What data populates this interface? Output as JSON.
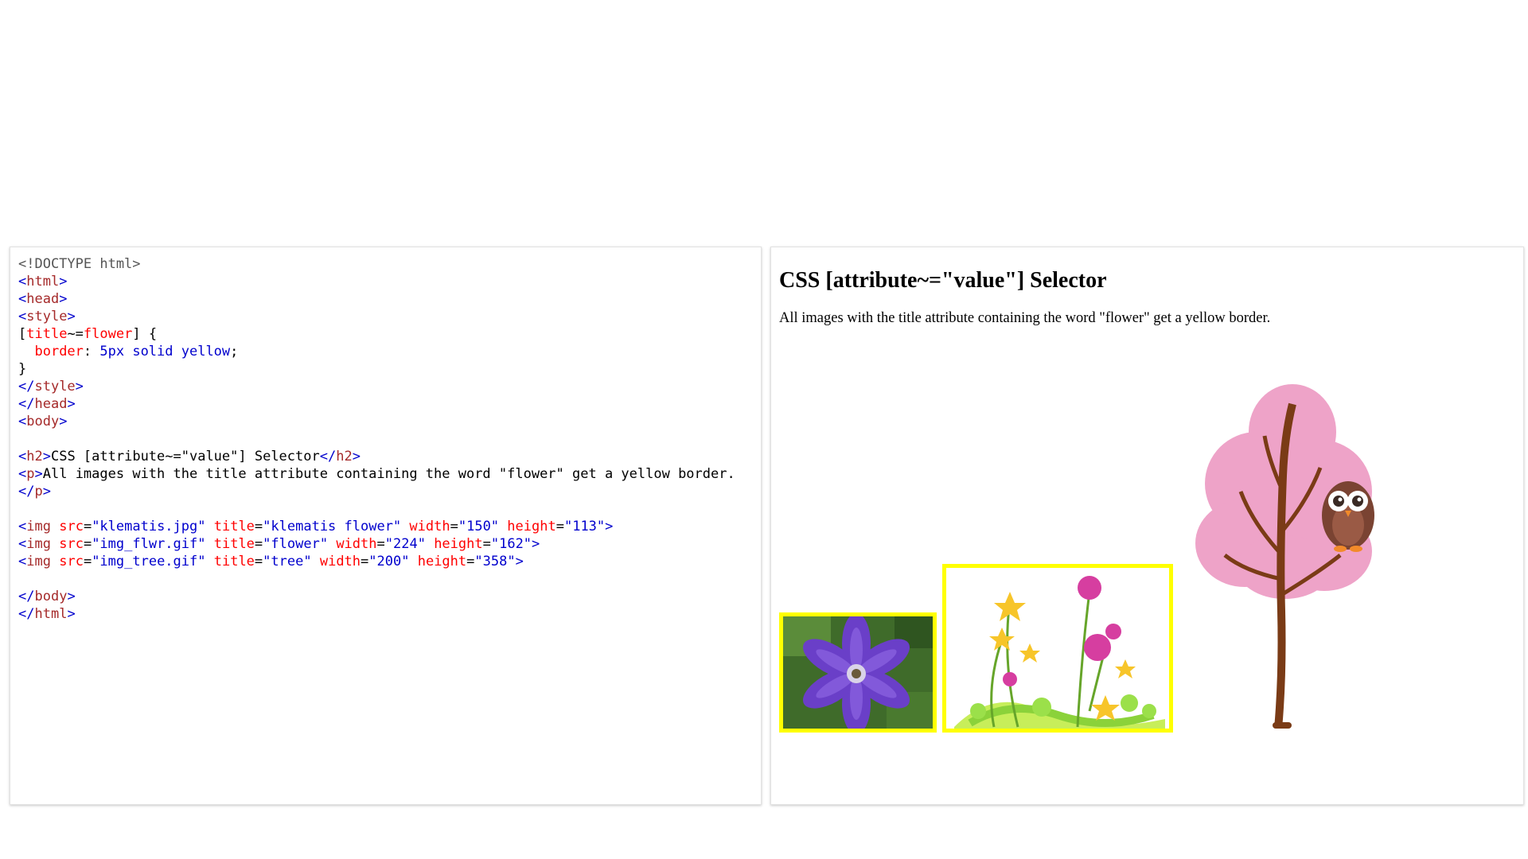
{
  "code_lines": [
    [
      [
        "tk-doc",
        "<!DOCTYPE html>"
      ]
    ],
    [
      [
        "tk-br",
        "<"
      ],
      [
        "tk-tag",
        "html"
      ],
      [
        "tk-br",
        ">"
      ]
    ],
    [
      [
        "tk-br",
        "<"
      ],
      [
        "tk-tag",
        "head"
      ],
      [
        "tk-br",
        ">"
      ]
    ],
    [
      [
        "tk-br",
        "<"
      ],
      [
        "tk-tag",
        "style"
      ],
      [
        "tk-br",
        ">"
      ]
    ],
    [
      [
        "tk-txt",
        "["
      ],
      [
        "tk-attr",
        "title"
      ],
      [
        "tk-txt",
        "~="
      ],
      [
        "tk-attr",
        "flower"
      ],
      [
        "tk-txt",
        "] {"
      ]
    ],
    [
      [
        "tk-txt",
        "  "
      ],
      [
        "tk-attr",
        "border"
      ],
      [
        "tk-txt",
        ": "
      ],
      [
        "tk-val",
        "5px solid yellow"
      ],
      [
        "tk-txt",
        ";"
      ]
    ],
    [
      [
        "tk-txt",
        "}"
      ]
    ],
    [
      [
        "tk-br",
        "</"
      ],
      [
        "tk-tag",
        "style"
      ],
      [
        "tk-br",
        ">"
      ]
    ],
    [
      [
        "tk-br",
        "</"
      ],
      [
        "tk-tag",
        "head"
      ],
      [
        "tk-br",
        ">"
      ]
    ],
    [
      [
        "tk-br",
        "<"
      ],
      [
        "tk-tag",
        "body"
      ],
      [
        "tk-br",
        ">"
      ]
    ],
    [],
    [
      [
        "tk-br",
        "<"
      ],
      [
        "tk-tag",
        "h2"
      ],
      [
        "tk-br",
        ">"
      ],
      [
        "tk-txt",
        "CSS [attribute~=\"value\"] Selector"
      ],
      [
        "tk-br",
        "</"
      ],
      [
        "tk-tag",
        "h2"
      ],
      [
        "tk-br",
        ">"
      ]
    ],
    [
      [
        "tk-br",
        "<"
      ],
      [
        "tk-tag",
        "p"
      ],
      [
        "tk-br",
        ">"
      ],
      [
        "tk-txt",
        "All images with the title attribute containing the word \"flower\" get a yellow border."
      ]
    ],
    [
      [
        "tk-br",
        "</"
      ],
      [
        "tk-tag",
        "p"
      ],
      [
        "tk-br",
        ">"
      ]
    ],
    [],
    [
      [
        "tk-br",
        "<"
      ],
      [
        "tk-tag",
        "img"
      ],
      [
        "tk-txt",
        " "
      ],
      [
        "tk-attr",
        "src"
      ],
      [
        "tk-txt",
        "="
      ],
      [
        "tk-val",
        "\"klematis.jpg\""
      ],
      [
        "tk-txt",
        " "
      ],
      [
        "tk-attr",
        "title"
      ],
      [
        "tk-txt",
        "="
      ],
      [
        "tk-val",
        "\"klematis flower\""
      ],
      [
        "tk-txt",
        " "
      ],
      [
        "tk-attr",
        "width"
      ],
      [
        "tk-txt",
        "="
      ],
      [
        "tk-val",
        "\"150\""
      ],
      [
        "tk-txt",
        " "
      ],
      [
        "tk-attr",
        "height"
      ],
      [
        "tk-txt",
        "="
      ],
      [
        "tk-val",
        "\"113\""
      ],
      [
        "tk-br",
        ">"
      ]
    ],
    [
      [
        "tk-br",
        "<"
      ],
      [
        "tk-tag",
        "img"
      ],
      [
        "tk-txt",
        " "
      ],
      [
        "tk-attr",
        "src"
      ],
      [
        "tk-txt",
        "="
      ],
      [
        "tk-val",
        "\"img_flwr.gif\""
      ],
      [
        "tk-txt",
        " "
      ],
      [
        "tk-attr",
        "title"
      ],
      [
        "tk-txt",
        "="
      ],
      [
        "tk-val",
        "\"flower\""
      ],
      [
        "tk-txt",
        " "
      ],
      [
        "tk-attr",
        "width"
      ],
      [
        "tk-txt",
        "="
      ],
      [
        "tk-val",
        "\"224\""
      ],
      [
        "tk-txt",
        " "
      ],
      [
        "tk-attr",
        "height"
      ],
      [
        "tk-txt",
        "="
      ],
      [
        "tk-val",
        "\"162\""
      ],
      [
        "tk-br",
        ">"
      ]
    ],
    [
      [
        "tk-br",
        "<"
      ],
      [
        "tk-tag",
        "img"
      ],
      [
        "tk-txt",
        " "
      ],
      [
        "tk-attr",
        "src"
      ],
      [
        "tk-txt",
        "="
      ],
      [
        "tk-val",
        "\"img_tree.gif\""
      ],
      [
        "tk-txt",
        " "
      ],
      [
        "tk-attr",
        "title"
      ],
      [
        "tk-txt",
        "="
      ],
      [
        "tk-val",
        "\"tree\""
      ],
      [
        "tk-txt",
        " "
      ],
      [
        "tk-attr",
        "width"
      ],
      [
        "tk-txt",
        "="
      ],
      [
        "tk-val",
        "\"200\""
      ],
      [
        "tk-txt",
        " "
      ],
      [
        "tk-attr",
        "height"
      ],
      [
        "tk-txt",
        "="
      ],
      [
        "tk-val",
        "\"358\""
      ],
      [
        "tk-br",
        ">"
      ]
    ],
    [],
    [
      [
        "tk-br",
        "</"
      ],
      [
        "tk-tag",
        "body"
      ],
      [
        "tk-br",
        ">"
      ]
    ],
    [
      [
        "tk-br",
        "</"
      ],
      [
        "tk-tag",
        "html"
      ],
      [
        "tk-br",
        ">"
      ]
    ]
  ],
  "result": {
    "heading": "CSS [attribute~=\"value\"] Selector",
    "paragraph": "All images with the title attribute containing the word \"flower\" get a yellow border.",
    "images": [
      {
        "id": "img-klematis",
        "name": "klematis-flower-image",
        "title": "klematis flower",
        "bordered": true
      },
      {
        "id": "img-flwr",
        "name": "flower-image",
        "title": "flower",
        "bordered": true
      },
      {
        "id": "img-tree",
        "name": "tree-image",
        "title": "tree",
        "bordered": false
      }
    ]
  },
  "colors": {
    "highlight_border": "#ffff00",
    "tag": "#a52a2a",
    "attribute": "#ff0000",
    "value": "#0000cd"
  }
}
